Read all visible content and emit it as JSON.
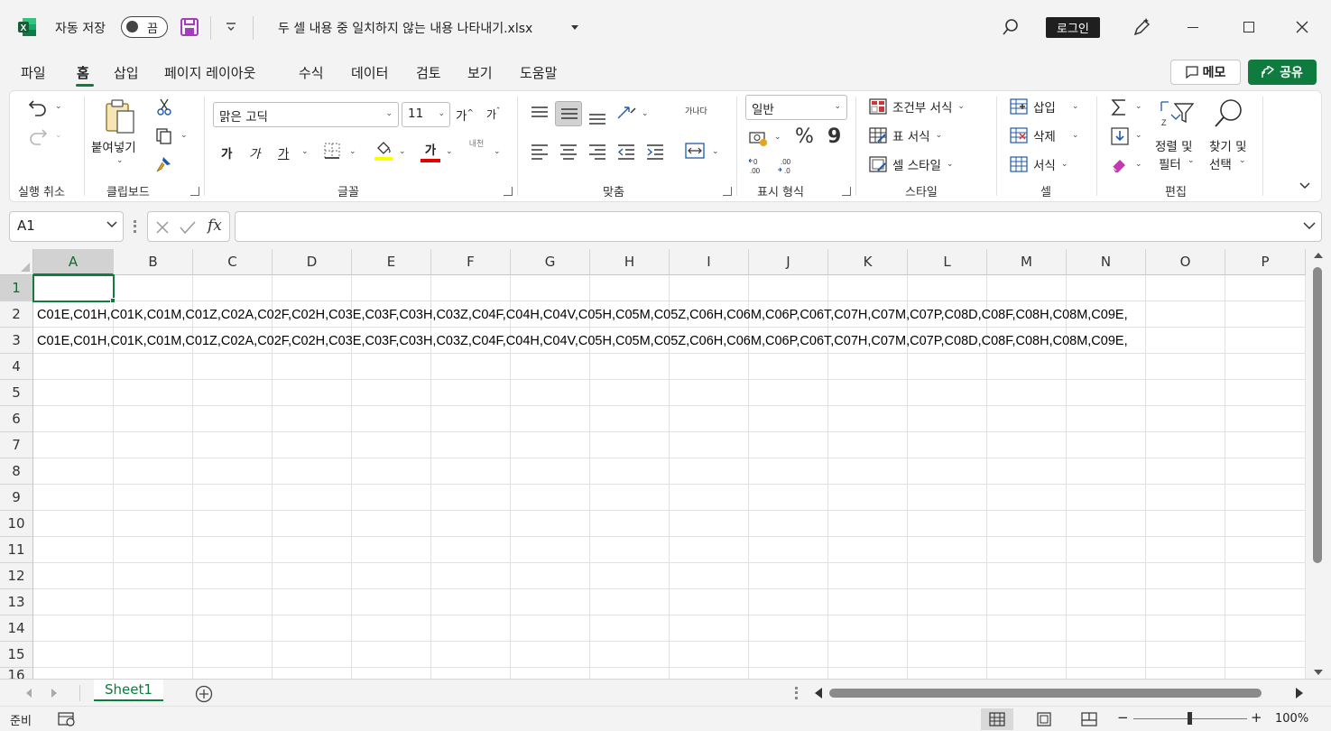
{
  "titlebar": {
    "autosave_label": "자동 저장",
    "autosave_state": "끔",
    "file_name": "두 셀 내용 중 일치하지 않는 내용 나타내기.xlsx",
    "login_label": "로그인"
  },
  "menu": {
    "tabs": [
      "파일",
      "홈",
      "삽입",
      "페이지 레이아웃",
      "수식",
      "데이터",
      "검토",
      "보기",
      "도움말"
    ],
    "active_tab": "홈",
    "memo_label": "메모",
    "share_label": "공유"
  },
  "ribbon": {
    "groups": {
      "undo": "실행 취소",
      "clipboard": "클립보드",
      "font": "글꼴",
      "alignment": "맞춤",
      "number": "표시 형식",
      "styles": "스타일",
      "cells": "셀",
      "editing": "편집"
    },
    "paste_label": "붙여넣기",
    "font_name": "맑은 고딕",
    "font_size": "11",
    "bold_glyph": "가",
    "italic_glyph": "가",
    "underline_glyph": "가",
    "font_color_glyph": "가",
    "grow_font": "가",
    "shrink_font": "가",
    "phonetic_label": "내천",
    "number_format": "일반",
    "percent_glyph": "%",
    "comma_glyph": "9",
    "cond_format_label": "조건부 서식",
    "table_format_label": "표 서식",
    "cell_style_label": "셀 스타일",
    "insert_label": "삽입",
    "delete_label": "삭제",
    "format_label": "서식",
    "sort_filter_label1": "정렬 및",
    "sort_filter_label2": "필터",
    "find_select_label1": "찾기 및",
    "find_select_label2": "선택",
    "wrap_text_label": "가나다"
  },
  "formula_bar": {
    "name_box": "A1",
    "fx_label": "fx",
    "formula": ""
  },
  "grid": {
    "columns": [
      "A",
      "B",
      "C",
      "D",
      "E",
      "F",
      "G",
      "H",
      "I",
      "J",
      "K",
      "L",
      "M",
      "N",
      "O",
      "P"
    ],
    "rows": [
      "1",
      "2",
      "3",
      "4",
      "5",
      "6",
      "7",
      "8",
      "9",
      "10",
      "11",
      "12",
      "13",
      "14",
      "15",
      "16"
    ],
    "selected_column": "A",
    "selected_row": "1",
    "cells": {
      "A2": "C01E,C01H,C01K,C01M,C01Z,C02A,C02F,C02H,C03E,C03F,C03H,C03Z,C04F,C04H,C04V,C05H,C05M,C05Z,C06H,C06M,C06P,C06T,C07H,C07M,C07P,C08D,C08F,C08H,C08M,C09E,",
      "A3": "C01E,C01H,C01K,C01M,C01Z,C02A,C02F,C02H,C03E,C03F,C03H,C03Z,C04F,C04H,C04V,C05H,C05M,C05Z,C06H,C06M,C06P,C06T,C07H,C07M,C07P,C08D,C08F,C08H,C08M,C09E,"
    }
  },
  "sheets": {
    "tabs": [
      "Sheet1"
    ],
    "active": "Sheet1"
  },
  "status": {
    "ready": "준비",
    "zoom": "100%",
    "zoom_minus": "−",
    "zoom_plus": "+"
  },
  "colors": {
    "accent": "#0f7b3f",
    "selection": "#107c41"
  }
}
